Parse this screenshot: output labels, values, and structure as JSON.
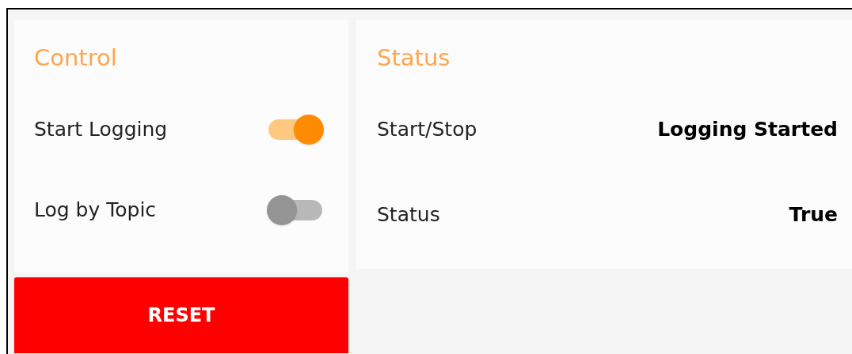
{
  "control": {
    "title": "Control",
    "toggles": [
      {
        "label": "Start Logging",
        "on": true
      },
      {
        "label": "Log by Topic",
        "on": false
      }
    ],
    "reset_button": "RESET"
  },
  "status": {
    "title": "Status",
    "rows": [
      {
        "label": "Start/Stop",
        "value": "Logging Started"
      },
      {
        "label": "Status",
        "value": "True"
      }
    ]
  }
}
